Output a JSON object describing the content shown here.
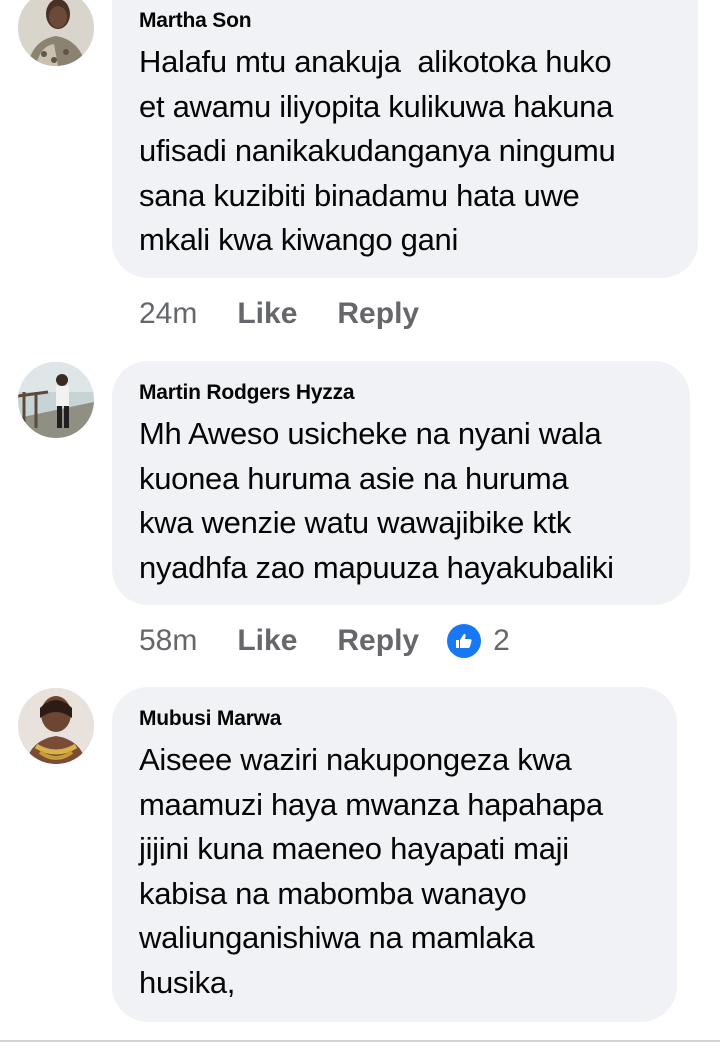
{
  "comments": [
    {
      "author": "Martha Son",
      "lines": [
        "Halafu mtu anakuja  alikotoka huko",
        "et awamu iliyopita kulikuwa hakuna",
        "ufisadi nanikakudanganya ningumu",
        "sana kuzibiti binadamu hata uwe",
        "mkali kwa kiwango gani"
      ],
      "time": "24m",
      "like_label": "Like",
      "reply_label": "Reply"
    },
    {
      "author": "Martin Rodgers Hyzza",
      "lines": [
        "Mh Aweso usicheke na nyani wala",
        "kuonea huruma asie na huruma",
        "kwa wenzie watu wawajibike ktk",
        "nyadhfa zao mapuuza hayakubaliki"
      ],
      "time": "58m",
      "like_label": "Like",
      "reply_label": "Reply",
      "reaction": {
        "icon": "thumbs-up-icon",
        "count": "2",
        "color": "#1877f2"
      }
    },
    {
      "author": "Mubusi Marwa",
      "lines": [
        "Aiseee waziri nakupongeza kwa",
        "maamuzi haya mwanza hapahapa",
        "jijini kuna maeneo hayapati maji",
        "kabisa na mabomba wanayo",
        "waliunganishiwa na mamlaka",
        "husika,"
      ]
    }
  ],
  "colors": {
    "bubble": "#f0f2f5",
    "meta_text": "#65676b",
    "like_blue": "#1877f2"
  }
}
